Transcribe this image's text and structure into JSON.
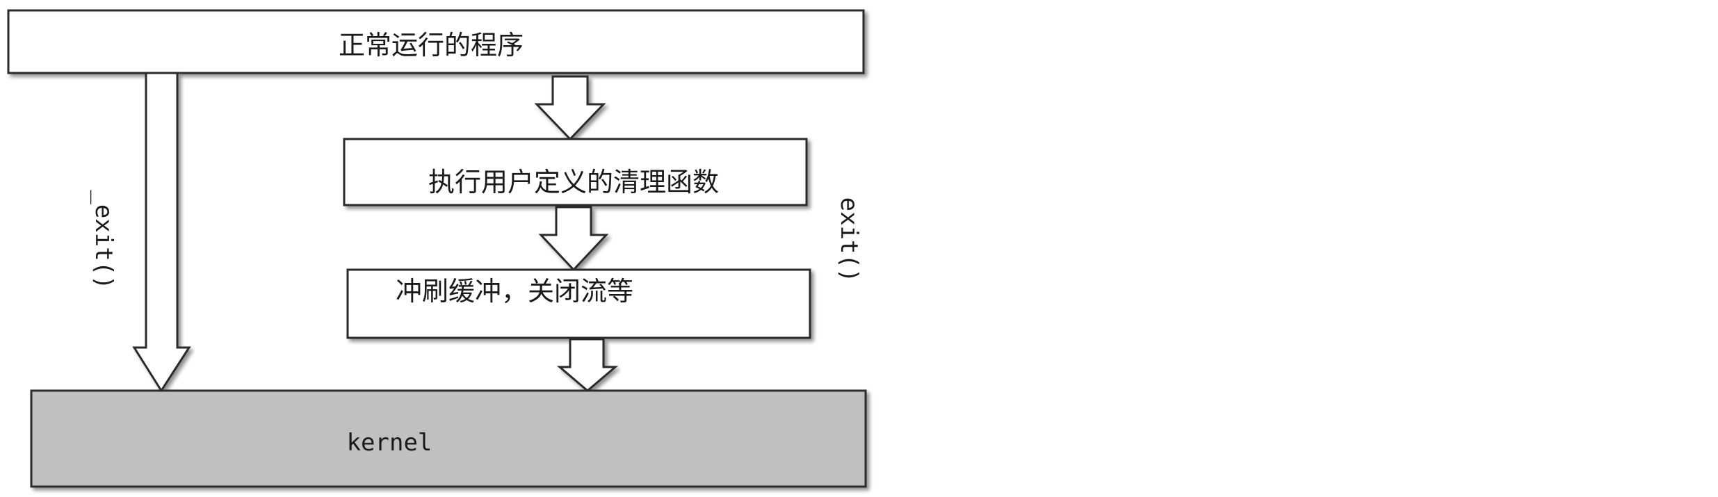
{
  "diagram": {
    "nodes": {
      "normal_program": "正常运行的程序",
      "user_cleanup": "执行用户定义的清理函数",
      "flush_close": "冲刷缓冲，关闭流等",
      "kernel": "kernel"
    },
    "edges": {
      "left_label": "_exit()",
      "right_label": "exit()"
    },
    "colors": {
      "box_fill": "#ffffff",
      "kernel_fill": "#c0c0c0",
      "stroke": "#2a2a2a",
      "shadow": "#8a8a8a"
    }
  }
}
